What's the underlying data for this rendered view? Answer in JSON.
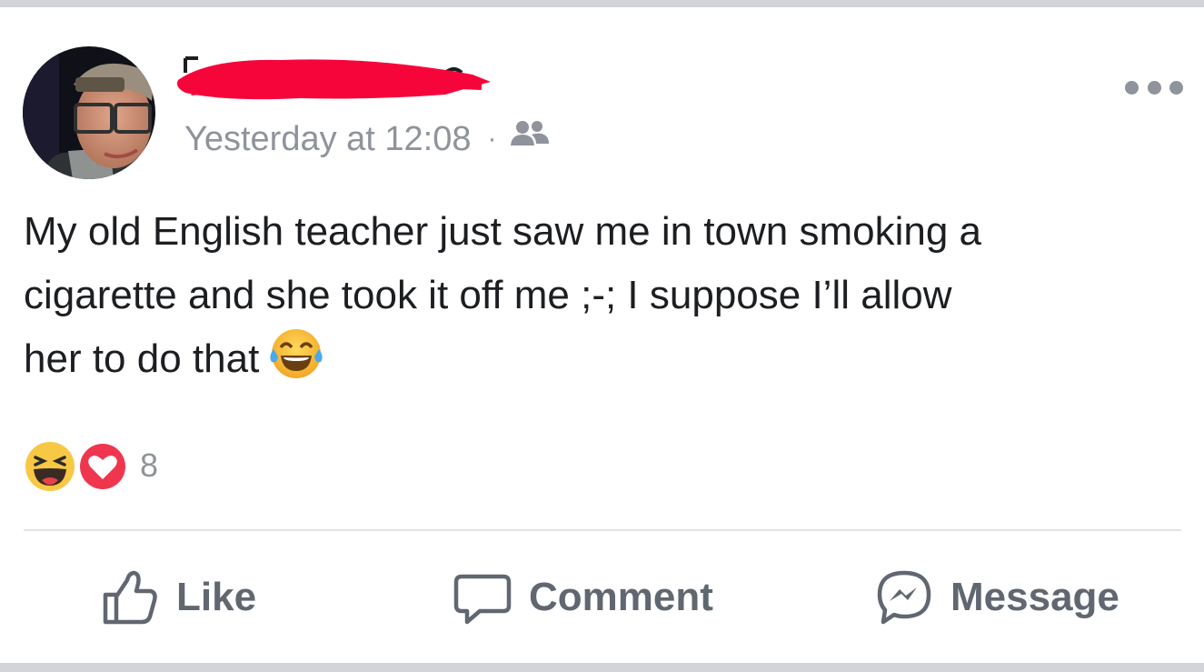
{
  "post": {
    "timestamp": "Yesterday at 12:08",
    "separator": "·",
    "audience_icon": "friends-icon",
    "text_line_1": "My old English teacher just saw me in town smoking a",
    "text_line_2": "cigarette and she took it off me ;-; I suppose I’ll allow",
    "text_line_3": "her to do that",
    "emoji": "tears-of-joy-emoji",
    "more_icon": "more-options-icon"
  },
  "reactions": {
    "icons": [
      "haha-reaction-icon",
      "love-reaction-icon"
    ],
    "count": "8"
  },
  "actions": {
    "like_label": "Like",
    "comment_label": "Comment",
    "message_label": "Message"
  },
  "colors": {
    "secondary_text": "#8f939b",
    "action_text": "#616770",
    "redaction": "#f6053b",
    "love_red": "#f0364f",
    "haha_yellow": "#f7c844"
  }
}
